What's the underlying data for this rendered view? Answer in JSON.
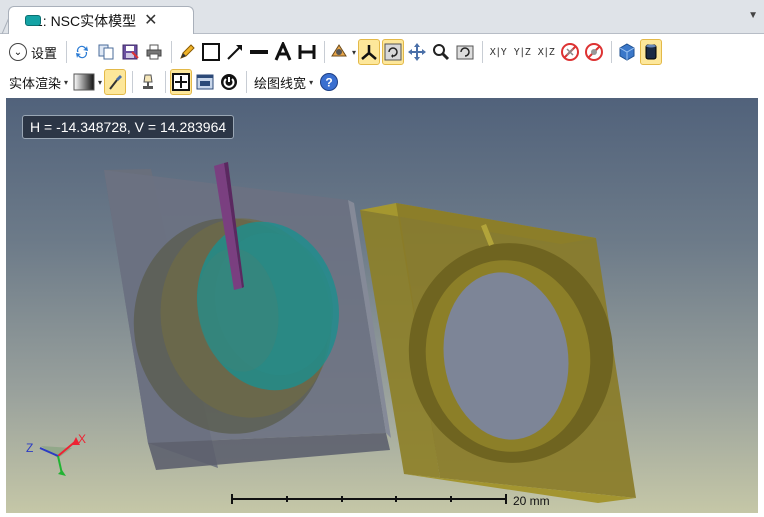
{
  "tab": {
    "title": "1: NSC实体模型",
    "close_glyph": "✕",
    "menu_glyph": "▼"
  },
  "toolbar1": {
    "settings_label": "设置",
    "axis_labels": [
      "X|Y",
      "Y|Z",
      "X|Z"
    ]
  },
  "toolbar2": {
    "render_label": "实体渲染",
    "line_width_label": "绘图线宽"
  },
  "viewport": {
    "coordinates": "H = -14.348728, V = 14.283964",
    "scale_bar_label": "20 mm",
    "triad_labels": {
      "x": "X",
      "z": "Z"
    }
  },
  "icons": [
    "settings-dropdown-icon",
    "refresh-icon",
    "copy-icon",
    "save-icon",
    "print-icon",
    "pencil-icon",
    "rectangle-icon",
    "arrow-icon",
    "line-icon",
    "text-icon",
    "dimension-icon",
    "rotate-object-icon",
    "axes-icon",
    "rotate-view-icon",
    "pan-icon",
    "zoom-icon",
    "reset-view-icon",
    "hide-ray-icon",
    "hide-ray-alt-icon",
    "cube-icon",
    "solid-cylinder-icon",
    "gradient-icon",
    "brush-icon",
    "lamp-icon",
    "grid-icon",
    "window-icon",
    "power-icon",
    "help-icon"
  ],
  "colors": {
    "highlight": "#fde79a",
    "tab_icon": "#14a3a5",
    "coord_bg": "#2c3646"
  }
}
